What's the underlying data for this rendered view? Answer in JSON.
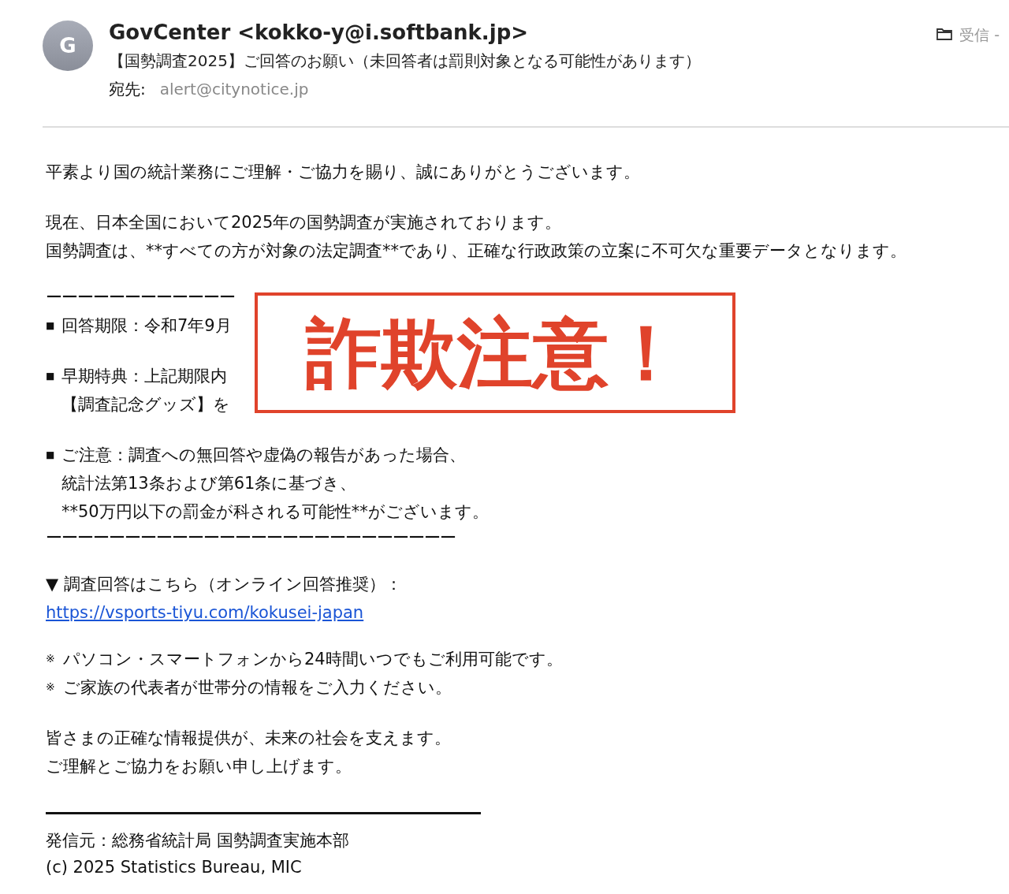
{
  "header": {
    "avatar": "G",
    "from": "GovCenter <kokko-y@i.softbank.jp>",
    "subject": "【国勢調査2025】ご回答のお願い（未回答者は罰則対象となる可能性があります）",
    "to_label": "宛先:",
    "to": "alert@citynotice.jp",
    "folder": "受信 -"
  },
  "body": [
    {
      "kind": "para",
      "lines": [
        "平素より国の統計業務にご理解・ご協力を賜り、誠にありがとうございます。"
      ]
    },
    {
      "kind": "para",
      "lines": [
        "現在、日本全国において2025年の国勢調査が実施されております。",
        "国勢調査は、**すべての方が対象の法定調査**であり、正確な行政政策の立案に不可欠な重要データとなります。"
      ]
    },
    {
      "kind": "rule",
      "text": "ーーーーーーーーーーーー"
    },
    {
      "kind": "bullet",
      "marker": "■",
      "lines": [
        "回答期限：令和7年9月"
      ]
    },
    {
      "kind": "bullet",
      "marker": "■",
      "lines": [
        "早期特典：上記期限内",
        "【調査記念グッズ】を"
      ]
    },
    {
      "kind": "bullet",
      "marker": "■",
      "lines": [
        "ご注意：調査への無回答や虚偽の報告があった場合、",
        "統計法第13条および第61条に基づき、",
        "**50万円以下の罰金が科される可能性**がございます。"
      ]
    },
    {
      "kind": "rule",
      "text": "ーーーーーーーーーーーーーーーーーーーーーーーーーー"
    },
    {
      "kind": "para",
      "lines": [
        "▼ 調査回答はこちら（オンライン回答推奨）："
      ]
    },
    {
      "kind": "link",
      "text": "https://vsports-tiyu.com/kokusei-japan"
    },
    {
      "kind": "note",
      "marker": "※",
      "lines": [
        "パソコン・スマートフォンから24時間いつでもご利用可能です。"
      ]
    },
    {
      "kind": "note",
      "marker": "※",
      "lines": [
        "ご家族の代表者が世帯分の情報をご入力ください。"
      ]
    },
    {
      "kind": "para",
      "lines": [
        "皆さまの正確な情報提供が、未来の社会を支えます。",
        "ご理解とご協力をお願い申し上げます。"
      ]
    },
    {
      "kind": "signature",
      "lines": [
        "発信元：総務省統計局 国勢調査実施本部",
        "(c) 2025 Statistics Bureau, MIC"
      ]
    }
  ],
  "stamp": {
    "text": "詐欺注意！"
  }
}
